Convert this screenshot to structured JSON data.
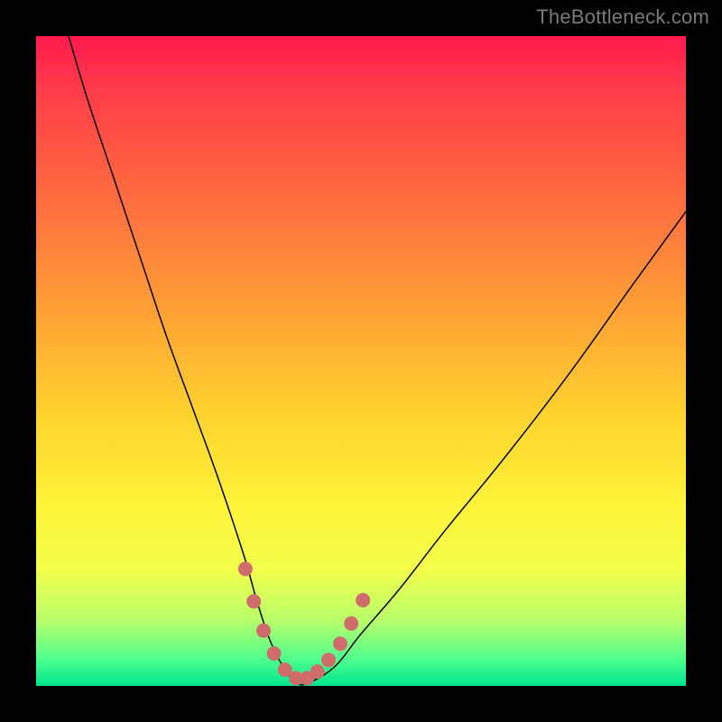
{
  "watermark": {
    "text": "TheBottleneck.com"
  },
  "chart_data": {
    "type": "line",
    "title": "",
    "xlabel": "",
    "ylabel": "",
    "xlim": [
      0,
      100
    ],
    "ylim": [
      0,
      100
    ],
    "grid": false,
    "legend": false,
    "background_gradient": {
      "top_color": "#ff1a4d",
      "mid_color": "#fff338",
      "bottom_color": "#00e58e"
    },
    "series": [
      {
        "name": "bottleneck-curve",
        "color": "#000000",
        "stroke_width": 1.5,
        "x": [
          5,
          8,
          12,
          16,
          20,
          24,
          28,
          32,
          34,
          36,
          38,
          40,
          42,
          46,
          50,
          56,
          63,
          72,
          82,
          92,
          100
        ],
        "y": [
          100,
          90,
          78,
          66,
          54,
          43,
          32,
          20,
          13,
          7,
          3,
          0.5,
          0.5,
          3,
          8,
          15,
          24,
          35,
          48,
          62,
          73
        ]
      },
      {
        "name": "highlight-markers",
        "color": "#cf6d6d",
        "marker": "circle",
        "marker_radius": 8,
        "x": [
          32.2,
          33.5,
          35.0,
          36.6,
          38.3,
          40.0,
          41.7,
          43.3,
          45.0,
          46.8,
          48.5,
          50.3
        ],
        "y": [
          18.0,
          13.0,
          8.5,
          5.0,
          2.5,
          1.2,
          1.2,
          2.2,
          4.0,
          6.5,
          9.6,
          13.2
        ]
      }
    ]
  }
}
